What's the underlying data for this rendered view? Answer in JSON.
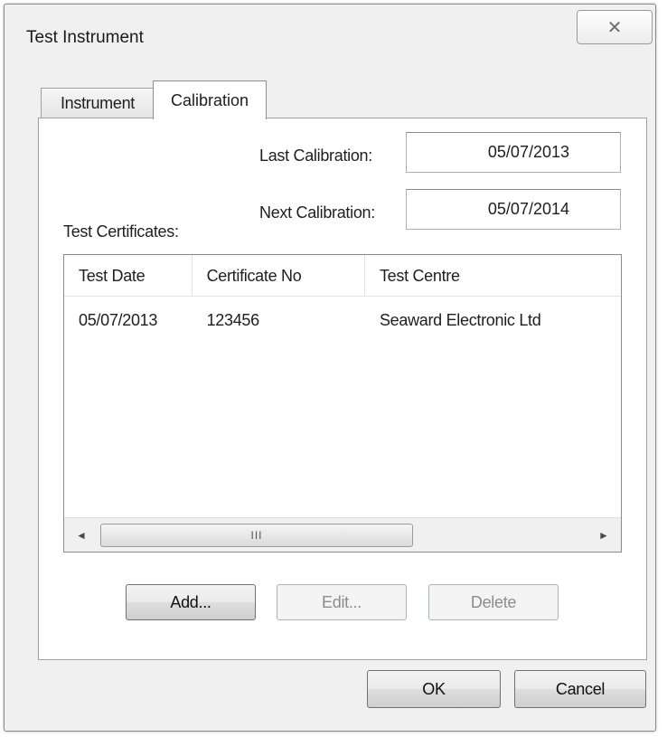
{
  "window": {
    "title": "Test Instrument",
    "close_glyph": "✕"
  },
  "tabs": [
    {
      "label": "Instrument",
      "selected": false
    },
    {
      "label": "Calibration",
      "selected": true
    }
  ],
  "calibration": {
    "last_calibration_label": "Last Calibration:",
    "last_calibration_value": "05/07/2013",
    "next_calibration_label": "Next Calibration:",
    "next_calibration_value": "05/07/2014",
    "certificates_label": "Test Certificates:"
  },
  "certificates_table": {
    "columns": [
      "Test Date",
      "Certificate No",
      "Test Centre"
    ],
    "rows": [
      [
        "05/07/2013",
        "123456",
        "Seaward Electronic Ltd"
      ]
    ],
    "scroll_left_glyph": "◄",
    "scroll_right_glyph": "►",
    "scroll_grip": "III"
  },
  "certificate_buttons": {
    "add": "Add...",
    "edit": "Edit...",
    "delete": "Delete"
  },
  "dialog_buttons": {
    "ok": "OK",
    "cancel": "Cancel"
  }
}
